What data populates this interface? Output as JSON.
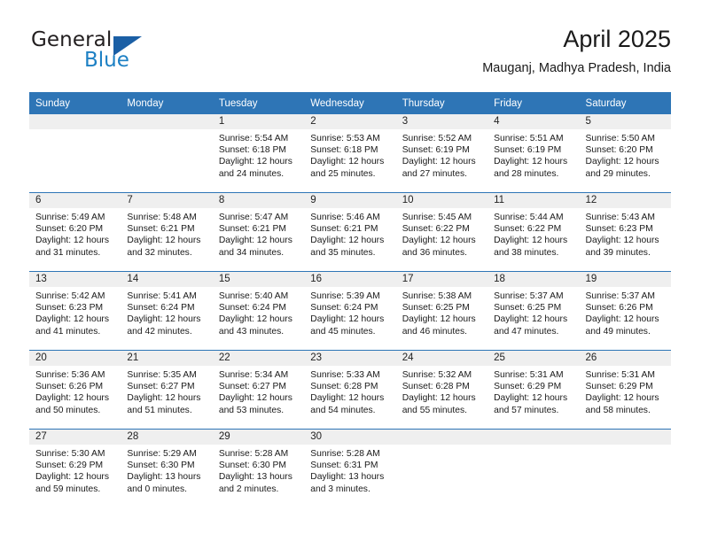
{
  "brand": {
    "name_part1": "General",
    "name_part2": "Blue",
    "triangle_icon": "triangle-icon"
  },
  "header": {
    "title": "April 2025",
    "subtitle": "Mauganj, Madhya Pradesh, India"
  },
  "theme": {
    "header_blue": "#2e75b6",
    "band_gray": "#efefef",
    "logo_blue": "#1d80c4",
    "logo_dark": "#231f20"
  },
  "calendar": {
    "weekday_headers": [
      "Sunday",
      "Monday",
      "Tuesday",
      "Wednesday",
      "Thursday",
      "Friday",
      "Saturday"
    ],
    "weeks": [
      [
        {
          "day": "",
          "sunrise": "",
          "sunset": "",
          "daylight_line1": "",
          "daylight_line2": ""
        },
        {
          "day": "",
          "sunrise": "",
          "sunset": "",
          "daylight_line1": "",
          "daylight_line2": ""
        },
        {
          "day": "1",
          "sunrise": "Sunrise: 5:54 AM",
          "sunset": "Sunset: 6:18 PM",
          "daylight_line1": "Daylight: 12 hours",
          "daylight_line2": "and 24 minutes."
        },
        {
          "day": "2",
          "sunrise": "Sunrise: 5:53 AM",
          "sunset": "Sunset: 6:18 PM",
          "daylight_line1": "Daylight: 12 hours",
          "daylight_line2": "and 25 minutes."
        },
        {
          "day": "3",
          "sunrise": "Sunrise: 5:52 AM",
          "sunset": "Sunset: 6:19 PM",
          "daylight_line1": "Daylight: 12 hours",
          "daylight_line2": "and 27 minutes."
        },
        {
          "day": "4",
          "sunrise": "Sunrise: 5:51 AM",
          "sunset": "Sunset: 6:19 PM",
          "daylight_line1": "Daylight: 12 hours",
          "daylight_line2": "and 28 minutes."
        },
        {
          "day": "5",
          "sunrise": "Sunrise: 5:50 AM",
          "sunset": "Sunset: 6:20 PM",
          "daylight_line1": "Daylight: 12 hours",
          "daylight_line2": "and 29 minutes."
        }
      ],
      [
        {
          "day": "6",
          "sunrise": "Sunrise: 5:49 AM",
          "sunset": "Sunset: 6:20 PM",
          "daylight_line1": "Daylight: 12 hours",
          "daylight_line2": "and 31 minutes."
        },
        {
          "day": "7",
          "sunrise": "Sunrise: 5:48 AM",
          "sunset": "Sunset: 6:21 PM",
          "daylight_line1": "Daylight: 12 hours",
          "daylight_line2": "and 32 minutes."
        },
        {
          "day": "8",
          "sunrise": "Sunrise: 5:47 AM",
          "sunset": "Sunset: 6:21 PM",
          "daylight_line1": "Daylight: 12 hours",
          "daylight_line2": "and 34 minutes."
        },
        {
          "day": "9",
          "sunrise": "Sunrise: 5:46 AM",
          "sunset": "Sunset: 6:21 PM",
          "daylight_line1": "Daylight: 12 hours",
          "daylight_line2": "and 35 minutes."
        },
        {
          "day": "10",
          "sunrise": "Sunrise: 5:45 AM",
          "sunset": "Sunset: 6:22 PM",
          "daylight_line1": "Daylight: 12 hours",
          "daylight_line2": "and 36 minutes."
        },
        {
          "day": "11",
          "sunrise": "Sunrise: 5:44 AM",
          "sunset": "Sunset: 6:22 PM",
          "daylight_line1": "Daylight: 12 hours",
          "daylight_line2": "and 38 minutes."
        },
        {
          "day": "12",
          "sunrise": "Sunrise: 5:43 AM",
          "sunset": "Sunset: 6:23 PM",
          "daylight_line1": "Daylight: 12 hours",
          "daylight_line2": "and 39 minutes."
        }
      ],
      [
        {
          "day": "13",
          "sunrise": "Sunrise: 5:42 AM",
          "sunset": "Sunset: 6:23 PM",
          "daylight_line1": "Daylight: 12 hours",
          "daylight_line2": "and 41 minutes."
        },
        {
          "day": "14",
          "sunrise": "Sunrise: 5:41 AM",
          "sunset": "Sunset: 6:24 PM",
          "daylight_line1": "Daylight: 12 hours",
          "daylight_line2": "and 42 minutes."
        },
        {
          "day": "15",
          "sunrise": "Sunrise: 5:40 AM",
          "sunset": "Sunset: 6:24 PM",
          "daylight_line1": "Daylight: 12 hours",
          "daylight_line2": "and 43 minutes."
        },
        {
          "day": "16",
          "sunrise": "Sunrise: 5:39 AM",
          "sunset": "Sunset: 6:24 PM",
          "daylight_line1": "Daylight: 12 hours",
          "daylight_line2": "and 45 minutes."
        },
        {
          "day": "17",
          "sunrise": "Sunrise: 5:38 AM",
          "sunset": "Sunset: 6:25 PM",
          "daylight_line1": "Daylight: 12 hours",
          "daylight_line2": "and 46 minutes."
        },
        {
          "day": "18",
          "sunrise": "Sunrise: 5:37 AM",
          "sunset": "Sunset: 6:25 PM",
          "daylight_line1": "Daylight: 12 hours",
          "daylight_line2": "and 47 minutes."
        },
        {
          "day": "19",
          "sunrise": "Sunrise: 5:37 AM",
          "sunset": "Sunset: 6:26 PM",
          "daylight_line1": "Daylight: 12 hours",
          "daylight_line2": "and 49 minutes."
        }
      ],
      [
        {
          "day": "20",
          "sunrise": "Sunrise: 5:36 AM",
          "sunset": "Sunset: 6:26 PM",
          "daylight_line1": "Daylight: 12 hours",
          "daylight_line2": "and 50 minutes."
        },
        {
          "day": "21",
          "sunrise": "Sunrise: 5:35 AM",
          "sunset": "Sunset: 6:27 PM",
          "daylight_line1": "Daylight: 12 hours",
          "daylight_line2": "and 51 minutes."
        },
        {
          "day": "22",
          "sunrise": "Sunrise: 5:34 AM",
          "sunset": "Sunset: 6:27 PM",
          "daylight_line1": "Daylight: 12 hours",
          "daylight_line2": "and 53 minutes."
        },
        {
          "day": "23",
          "sunrise": "Sunrise: 5:33 AM",
          "sunset": "Sunset: 6:28 PM",
          "daylight_line1": "Daylight: 12 hours",
          "daylight_line2": "and 54 minutes."
        },
        {
          "day": "24",
          "sunrise": "Sunrise: 5:32 AM",
          "sunset": "Sunset: 6:28 PM",
          "daylight_line1": "Daylight: 12 hours",
          "daylight_line2": "and 55 minutes."
        },
        {
          "day": "25",
          "sunrise": "Sunrise: 5:31 AM",
          "sunset": "Sunset: 6:29 PM",
          "daylight_line1": "Daylight: 12 hours",
          "daylight_line2": "and 57 minutes."
        },
        {
          "day": "26",
          "sunrise": "Sunrise: 5:31 AM",
          "sunset": "Sunset: 6:29 PM",
          "daylight_line1": "Daylight: 12 hours",
          "daylight_line2": "and 58 minutes."
        }
      ],
      [
        {
          "day": "27",
          "sunrise": "Sunrise: 5:30 AM",
          "sunset": "Sunset: 6:29 PM",
          "daylight_line1": "Daylight: 12 hours",
          "daylight_line2": "and 59 minutes."
        },
        {
          "day": "28",
          "sunrise": "Sunrise: 5:29 AM",
          "sunset": "Sunset: 6:30 PM",
          "daylight_line1": "Daylight: 13 hours",
          "daylight_line2": "and 0 minutes."
        },
        {
          "day": "29",
          "sunrise": "Sunrise: 5:28 AM",
          "sunset": "Sunset: 6:30 PM",
          "daylight_line1": "Daylight: 13 hours",
          "daylight_line2": "and 2 minutes."
        },
        {
          "day": "30",
          "sunrise": "Sunrise: 5:28 AM",
          "sunset": "Sunset: 6:31 PM",
          "daylight_line1": "Daylight: 13 hours",
          "daylight_line2": "and 3 minutes."
        },
        {
          "day": "",
          "sunrise": "",
          "sunset": "",
          "daylight_line1": "",
          "daylight_line2": ""
        },
        {
          "day": "",
          "sunrise": "",
          "sunset": "",
          "daylight_line1": "",
          "daylight_line2": ""
        },
        {
          "day": "",
          "sunrise": "",
          "sunset": "",
          "daylight_line1": "",
          "daylight_line2": ""
        }
      ]
    ]
  }
}
